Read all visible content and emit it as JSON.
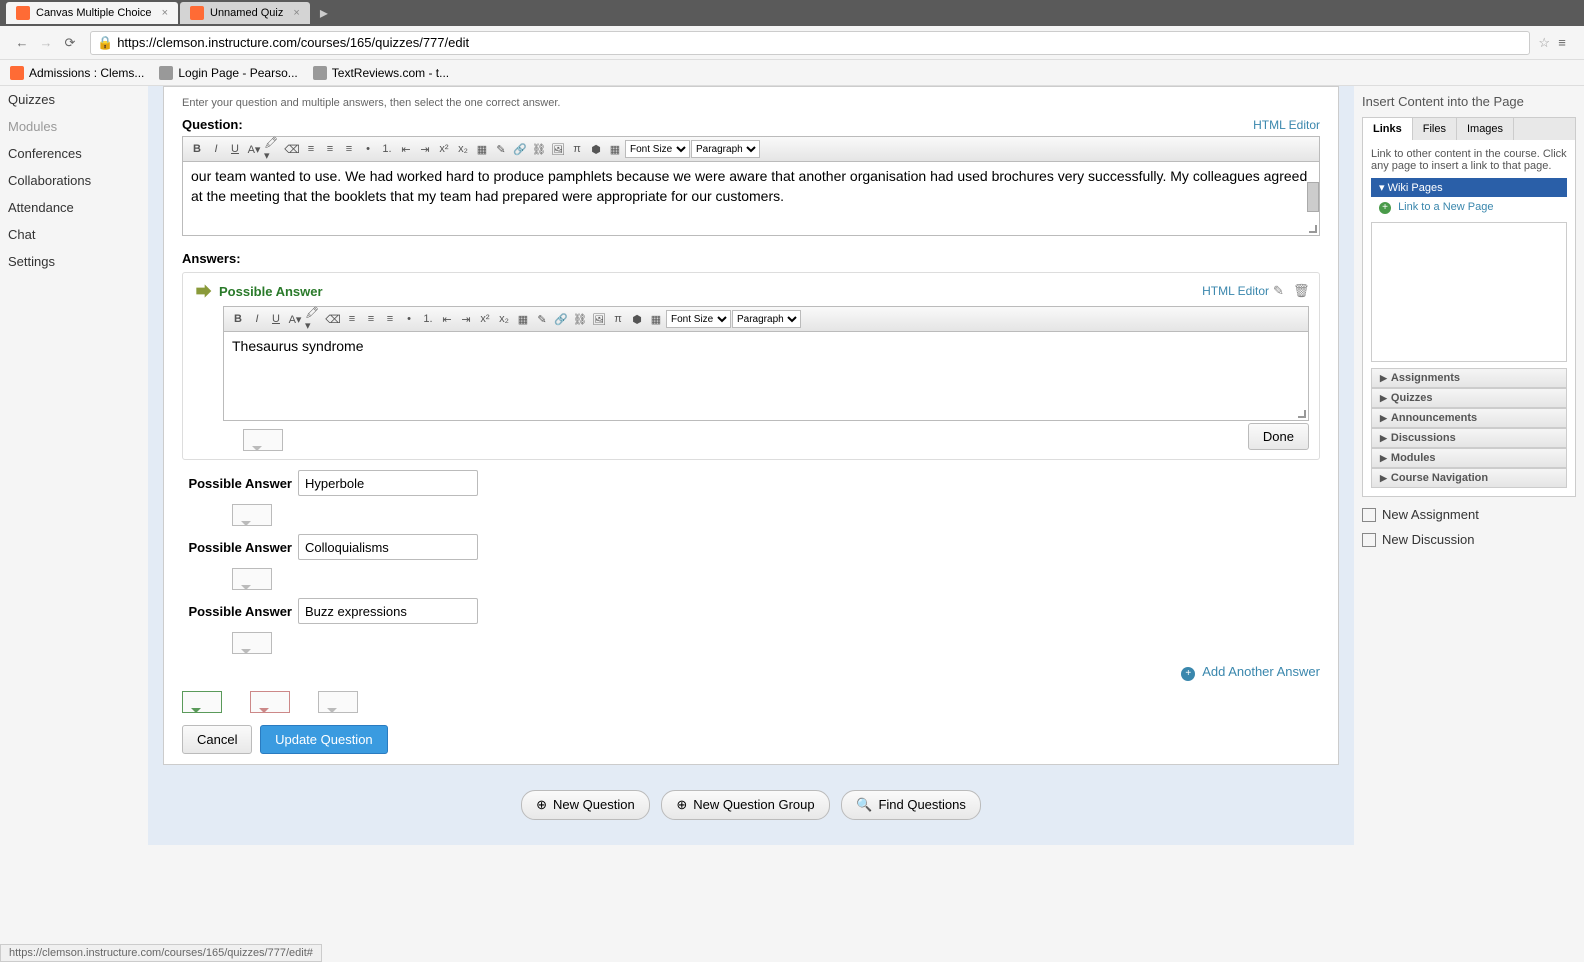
{
  "browser": {
    "tabs": [
      {
        "title": "Canvas Multiple Choice",
        "active": true
      },
      {
        "title": "Unnamed Quiz",
        "active": false
      }
    ],
    "url": "https://clemson.instructure.com/courses/165/quizzes/777/edit",
    "bookmarks": [
      {
        "label": "Admissions : Clems..."
      },
      {
        "label": "Login Page - Pearso..."
      },
      {
        "label": "TextReviews.com - t..."
      }
    ]
  },
  "leftNav": {
    "items": [
      {
        "label": "Quizzes",
        "dim": false
      },
      {
        "label": "Modules",
        "dim": true
      },
      {
        "label": "Conferences",
        "dim": false
      },
      {
        "label": "Collaborations",
        "dim": false
      },
      {
        "label": "Attendance",
        "dim": false
      },
      {
        "label": "Chat",
        "dim": false
      },
      {
        "label": "Settings",
        "dim": false
      }
    ]
  },
  "question": {
    "hint": "Enter your question and multiple answers, then select the one correct answer.",
    "label": "Question:",
    "htmlEditor": "HTML Editor",
    "text": "our team wanted to use. We had worked hard to produce pamphlets because we were aware that another organisation had used brochures very successfully. My colleagues agreed at the meeting that the booklets that my team had prepared were appropriate for our customers.",
    "fontSize": "Font Size",
    "paragraph": "Paragraph"
  },
  "answers": {
    "label": "Answers:",
    "possible": "Possible Answer",
    "htmlEditor": "HTML Editor",
    "done": "Done",
    "editor": {
      "text": "Thesaurus syndrome"
    },
    "list": [
      {
        "value": "Hyperbole"
      },
      {
        "value": "Colloquialisms"
      },
      {
        "value": "Buzz expressions"
      }
    ],
    "addAnother": "Add Another Answer"
  },
  "buttons": {
    "cancel": "Cancel",
    "update": "Update Question",
    "newQuestion": "New Question",
    "newGroup": "New Question Group",
    "findQuestions": "Find Questions"
  },
  "rightPanel": {
    "title": "Insert Content into the Page",
    "tabs": [
      {
        "label": "Links",
        "active": true
      },
      {
        "label": "Files",
        "active": false
      },
      {
        "label": "Images",
        "active": false
      }
    ],
    "linkHint": "Link to other content in the course. Click any page to insert a link to that page.",
    "wikiHeader": "Wiki Pages",
    "newPageLink": "Link to a New Page",
    "accordion": [
      {
        "label": "Assignments"
      },
      {
        "label": "Quizzes"
      },
      {
        "label": "Announcements"
      },
      {
        "label": "Discussions"
      },
      {
        "label": "Modules"
      },
      {
        "label": "Course Navigation"
      }
    ],
    "newAssignment": "New Assignment",
    "newDiscussion": "New Discussion"
  },
  "status": "https://clemson.instructure.com/courses/165/quizzes/777/edit#"
}
